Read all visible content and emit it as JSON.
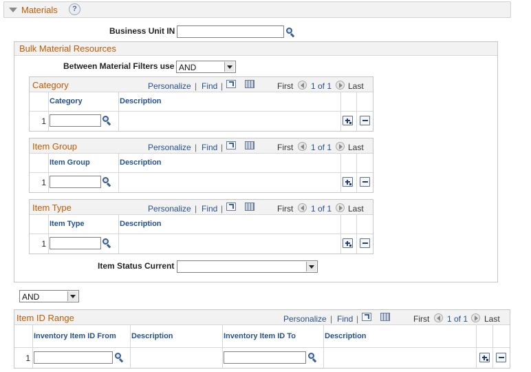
{
  "section": {
    "title": "Materials",
    "help": "?"
  },
  "business_unit": {
    "label": "Business Unit IN",
    "value": ""
  },
  "bulk": {
    "title": "Bulk Material Resources",
    "filters_label": "Between Material Filters use",
    "filters_value": "AND"
  },
  "grid_toolbar": {
    "personalize": "Personalize",
    "find": "Find",
    "sep": "|",
    "first": "First",
    "pager": "1 of 1",
    "last": "Last"
  },
  "category": {
    "title": "Category",
    "col1": "Category",
    "col2": "Description",
    "row": "1"
  },
  "item_group": {
    "title": "Item Group",
    "col1": "Item Group",
    "col2": "Description",
    "row": "1"
  },
  "item_type": {
    "title": "Item Type",
    "col1": "Item Type",
    "col2": "Description",
    "row": "1"
  },
  "item_status": {
    "label": "Item Status Current",
    "value": ""
  },
  "outer_and": {
    "value": "AND"
  },
  "item_id_range": {
    "title": "Item ID Range",
    "col1": "Inventory Item ID From",
    "col2": "Description",
    "col3": "Inventory Item ID To",
    "col4": "Description",
    "row": "1"
  }
}
